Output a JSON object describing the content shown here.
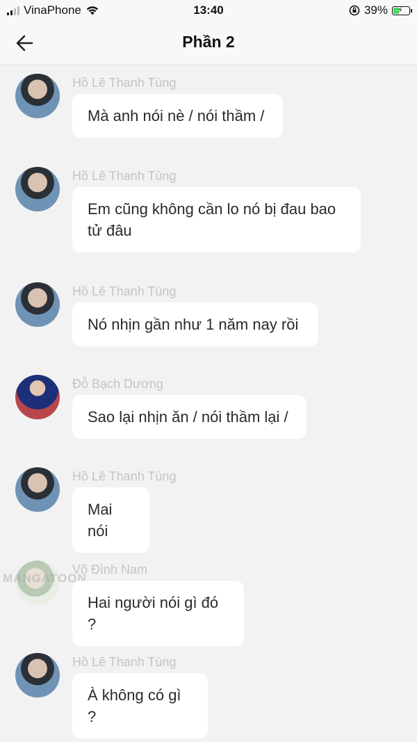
{
  "status_bar": {
    "carrier": "VinaPhone",
    "time": "13:40",
    "battery": "39%",
    "battery_level": 0.39,
    "icons": [
      "signal-icon",
      "wifi-icon",
      "orientation-lock-icon",
      "battery-charging-icon"
    ]
  },
  "header": {
    "title": "Phần 2",
    "back_icon": "arrow-left-icon"
  },
  "messages": [
    {
      "sender": "Hồ Lê Thanh Tùng",
      "text": "Mà anh nói nè / nói thầm /"
    },
    {
      "sender": "Hồ Lê Thanh Tùng",
      "text": "Em cũng không cần lo nó bị đau bao tử đâu"
    },
    {
      "sender": "Hồ Lê Thanh Tùng",
      "text": "Nó nhịn gần như 1 năm nay rồi"
    },
    {
      "sender": "Đỗ Bạch Dương",
      "text": "Sao lại nhịn ăn / nói thầm lại /"
    },
    {
      "sender": "Hồ Lê Thanh Tùng",
      "text": "Mai nói"
    },
    {
      "sender": "Võ Đình Nam",
      "text": "Hai người nói gì đó ?",
      "watermark": "MANGATOON"
    },
    {
      "sender": "Hồ Lê Thanh Tùng",
      "text": "À không có gì ?"
    }
  ]
}
